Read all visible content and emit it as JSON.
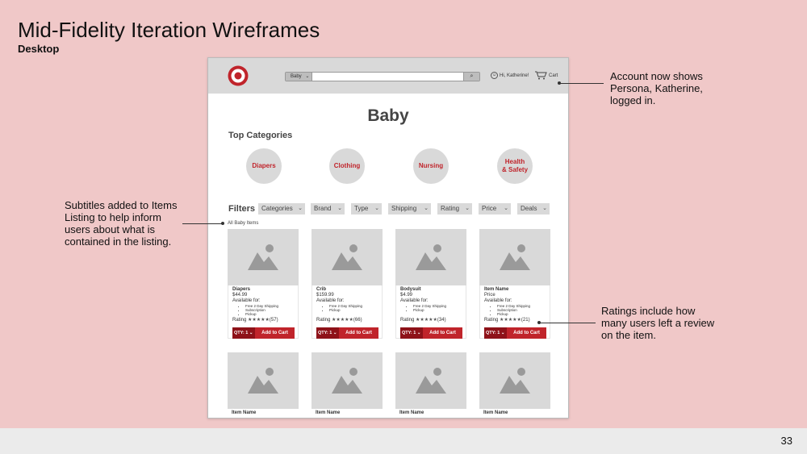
{
  "slide": {
    "title": "Mid-Fidelity Iteration Wireframes",
    "subtitle": "Desktop",
    "page_number": "33",
    "notes": [
      "Account now shows Persona, Katherine, logged in.",
      "Subtitles added to Items Listing to help inform users about what is contained in the listing.",
      "Ratings include how many users left a review on the item."
    ]
  },
  "header": {
    "search_category": "Baby",
    "account_label": "Hi, Katherine!",
    "cart_label": "Cart"
  },
  "page": {
    "title": "Baby",
    "top_categories_label": "Top Categories",
    "categories": [
      "Diapers",
      "Clothing",
      "Nursing",
      "Health & Safety"
    ],
    "filters_label": "Filters",
    "filters": [
      "Categories",
      "Brand",
      "Type",
      "Shipping",
      "Rating",
      "Price",
      "Deals"
    ],
    "breadcrumb": "All Baby Items"
  },
  "products": [
    {
      "name": "Diapers",
      "price": "$44.99",
      "available": "Available for:",
      "options": [
        "Free 2 Day Shipping",
        "Subscription",
        "Pickup"
      ],
      "rating_label": "Rating",
      "stars": "★★★★★",
      "reviews": "(57)",
      "qty": "QTY: 1",
      "add": "Add to Cart"
    },
    {
      "name": "Crib",
      "price": "$159.99",
      "available": "Available for:",
      "options": [
        "Free 2 Day Shipping",
        "Pickup"
      ],
      "rating_label": "Rating",
      "stars": "★★★★★",
      "reviews": "(66)",
      "qty": "QTY: 1",
      "add": "Add to Cart"
    },
    {
      "name": "Bodysuit",
      "price": "$4.99",
      "available": "Available for:",
      "options": [
        "Free 2 Day Shipping",
        "Pickup"
      ],
      "rating_label": "Rating",
      "stars": "★★★★★",
      "reviews": "(34)",
      "qty": "QTY: 1",
      "add": "Add to Cart"
    },
    {
      "name": "Item Name",
      "price": "Price",
      "available": "Available for:",
      "options": [
        "Free 2 Day Shipping",
        "Subscription",
        "Pickup"
      ],
      "rating_label": "Rating",
      "stars": "★★★★★",
      "reviews": "(21)",
      "qty": "QTY: 1",
      "add": "Add to Cart"
    }
  ],
  "products_row2": [
    {
      "name": "Item Name"
    },
    {
      "name": "Item Name"
    },
    {
      "name": "Item Name"
    },
    {
      "name": "Item Name"
    }
  ],
  "colors": {
    "background": "#f0c8c8",
    "brand_red": "#c0242b",
    "dark_red": "#8e1219",
    "placeholder_gray": "#d9d9d9"
  }
}
